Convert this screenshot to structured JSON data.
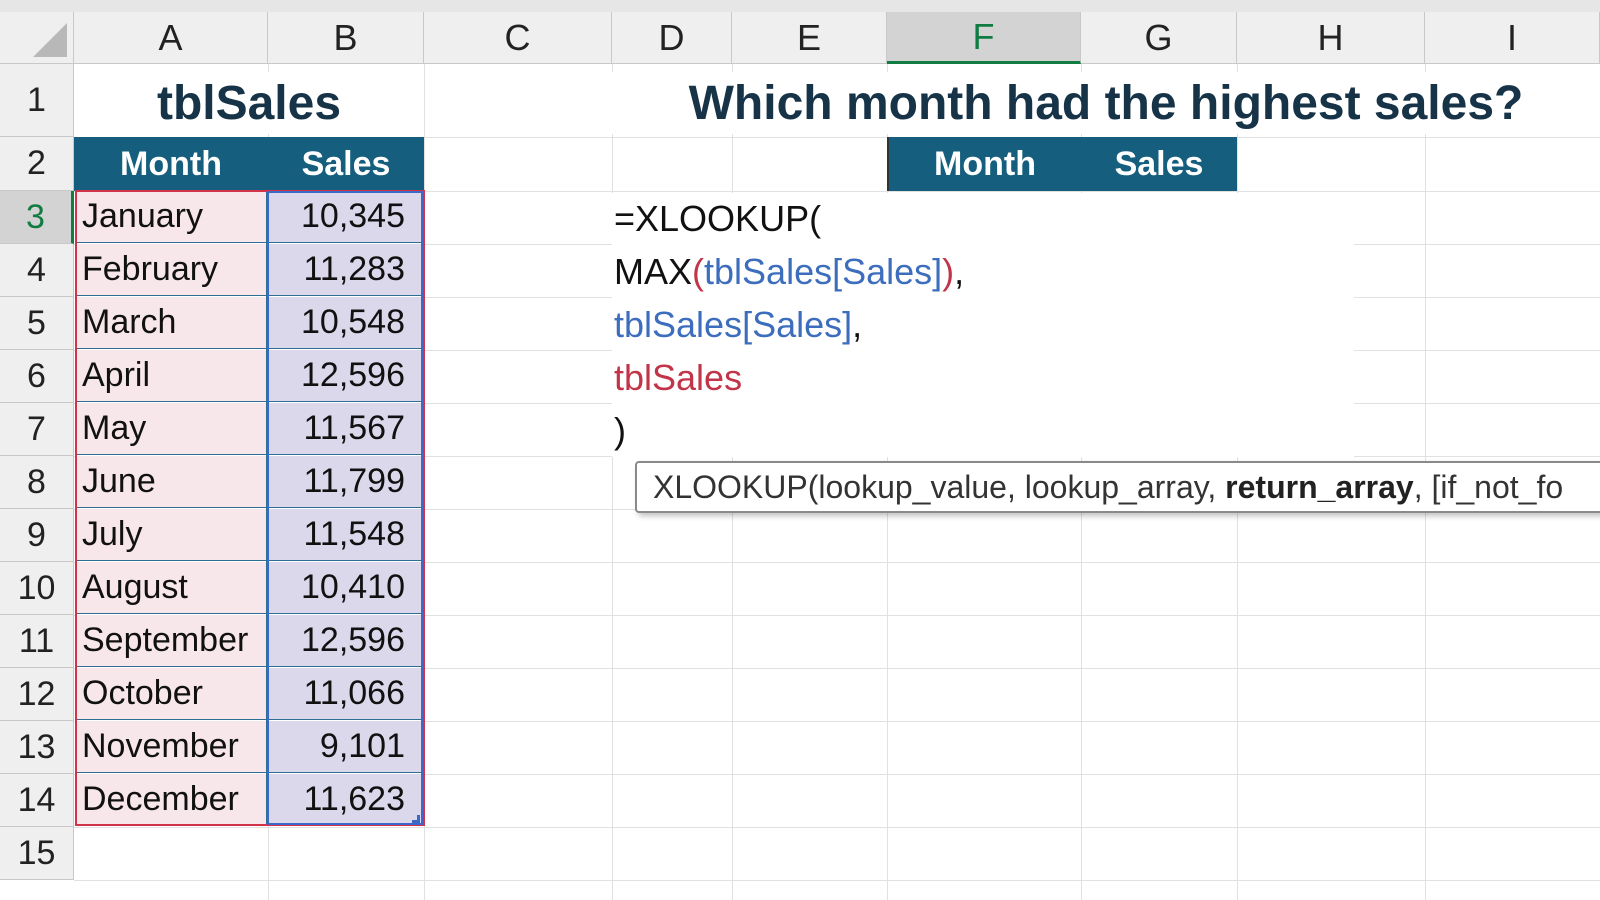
{
  "columns": [
    "A",
    "B",
    "C",
    "D",
    "E",
    "F",
    "G",
    "H",
    "I"
  ],
  "active_column": "F",
  "rows": [
    "1",
    "2",
    "3",
    "4",
    "5",
    "6",
    "7",
    "8",
    "9",
    "10",
    "11",
    "12",
    "13",
    "14",
    "15"
  ],
  "active_row": "3",
  "table": {
    "title": "tblSales",
    "headers": {
      "month": "Month",
      "sales": "Sales"
    },
    "rows": [
      {
        "month": "January",
        "sales": "10,345"
      },
      {
        "month": "February",
        "sales": "11,283"
      },
      {
        "month": "March",
        "sales": "10,548"
      },
      {
        "month": "April",
        "sales": "12,596"
      },
      {
        "month": "May",
        "sales": "11,567"
      },
      {
        "month": "June",
        "sales": "11,799"
      },
      {
        "month": "July",
        "sales": "11,548"
      },
      {
        "month": "August",
        "sales": "10,410"
      },
      {
        "month": "September",
        "sales": "12,596"
      },
      {
        "month": "October",
        "sales": "11,066"
      },
      {
        "month": "November",
        "sales": "9,101"
      },
      {
        "month": "December",
        "sales": "11,623"
      }
    ]
  },
  "question": {
    "title": "Which month had the highest sales?",
    "headers": {
      "month": "Month",
      "sales": "Sales"
    }
  },
  "formula": {
    "line1": "=XLOOKUP(",
    "line2_fn": "MAX",
    "line2_open": "(",
    "line2_ref": "tblSales[Sales]",
    "line2_close": ")",
    "line2_comma": ",",
    "line3_ref": "tblSales[Sales]",
    "line3_comma": ",",
    "line4_ref": "tblSales",
    "line5": ")"
  },
  "tooltip": {
    "prefix": "XLOOKUP(lookup_value, lookup_array, ",
    "bold": "return_array",
    "suffix": ", [if_not_fo"
  },
  "colors": {
    "header_fill": "#155e7d",
    "month_fill": "#f7e7ea",
    "sales_fill": "#dcd8eb",
    "ref_blue": "#3d6dbd",
    "ref_red": "#c23549",
    "title_text": "#173347",
    "active_header": "#107c41"
  }
}
